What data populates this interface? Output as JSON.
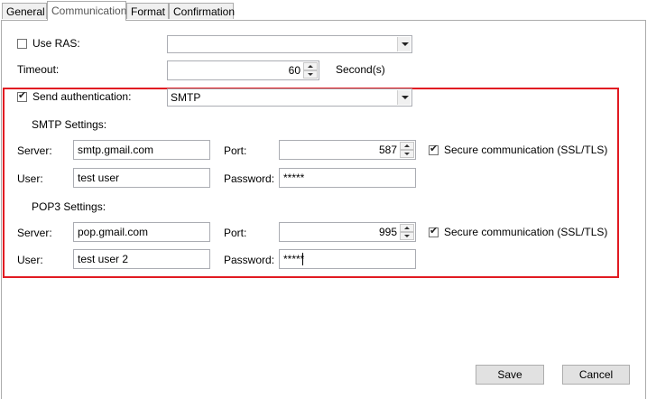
{
  "tabs": [
    {
      "label": "General"
    },
    {
      "label": "Communication",
      "active": true
    },
    {
      "label": "Format"
    },
    {
      "label": "Confirmation"
    }
  ],
  "use_ras": {
    "label": "Use RAS:",
    "checked": false,
    "value": ""
  },
  "timeout": {
    "label": "Timeout:",
    "value": "60",
    "unit": "Second(s)"
  },
  "send_auth": {
    "label": "Send authentication:",
    "checked": true,
    "value": "SMTP"
  },
  "smtp": {
    "heading": "SMTP Settings:",
    "server_label": "Server:",
    "server": "smtp.gmail.com",
    "port_label": "Port:",
    "port": "587",
    "secure_label": "Secure communication (SSL/TLS)",
    "secure_checked": true,
    "user_label": "User:",
    "user": "test user",
    "password_label": "Password:",
    "password": "*****"
  },
  "pop3": {
    "heading": "POP3 Settings:",
    "server_label": "Server:",
    "server": "pop.gmail.com",
    "port_label": "Port:",
    "port": "995",
    "secure_label": "Secure communication (SSL/TLS)",
    "secure_checked": true,
    "user_label": "User:",
    "user": "test user 2",
    "password_label": "Password:",
    "password": "*****"
  },
  "buttons": {
    "save": "Save",
    "cancel": "Cancel"
  },
  "colors": {
    "highlight_border": "#e11b22"
  }
}
